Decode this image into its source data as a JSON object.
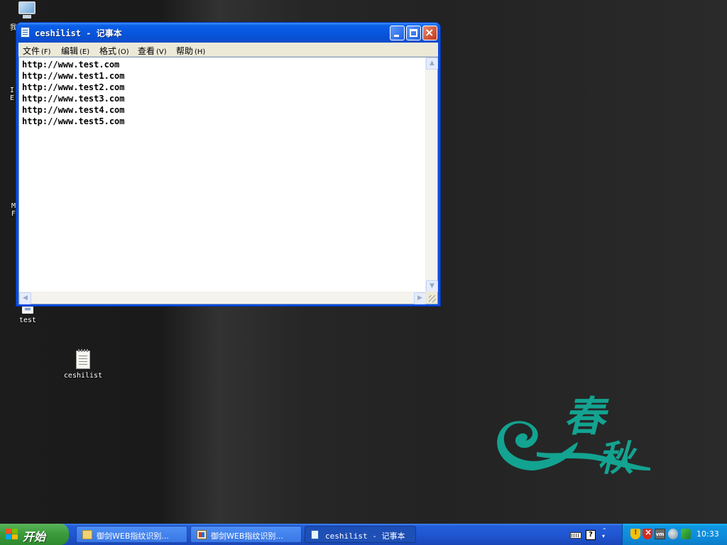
{
  "desktop": {
    "icons": {
      "my_computer": {
        "label": "我"
      },
      "test": {
        "label": "test"
      },
      "ceshilist": {
        "label": "ceshilist"
      }
    },
    "partial_labels": {
      "ie_line1": "I",
      "ie_line2": "E",
      "mid_line1": "M",
      "mid_line2": "F"
    },
    "logo": {
      "text_top": "春",
      "text_bottom": "秋",
      "color": "#13a391"
    }
  },
  "window": {
    "title": "ceshilist - 记事本",
    "menu": [
      {
        "label": "文件",
        "mnemonic": "(F)"
      },
      {
        "label": "编辑",
        "mnemonic": "(E)"
      },
      {
        "label": "格式",
        "mnemonic": "(O)"
      },
      {
        "label": "查看",
        "mnemonic": "(V)"
      },
      {
        "label": "帮助",
        "mnemonic": "(H)"
      }
    ],
    "content_lines": [
      "http://www.test.com",
      "http://www.test1.com",
      "http://www.test2.com",
      "http://www.test3.com",
      "http://www.test4.com",
      "http://www.test5.com"
    ],
    "scroll_glyphs": {
      "up": "▲",
      "down": "▼",
      "left": "◀",
      "right": "▶"
    }
  },
  "taskbar": {
    "start_label": "开始",
    "tasks": [
      {
        "label": "御剑WEB指纹识别...",
        "icon": "folder-icon",
        "active": false
      },
      {
        "label": "御剑WEB指纹识别...",
        "icon": "app-icon",
        "active": false
      },
      {
        "label": "ceshilist - 记事本",
        "icon": "notepad-icon",
        "active": true
      }
    ],
    "lang_bar": {
      "help_glyph": "?",
      "options_glyph": "⌃"
    },
    "tray": {
      "vm_label": "vm",
      "clock": "10:33"
    }
  },
  "colors": {
    "titlebar_blue": "#0a55dd",
    "start_green": "#3c9b3c",
    "tray_blue": "#0f96e2"
  }
}
